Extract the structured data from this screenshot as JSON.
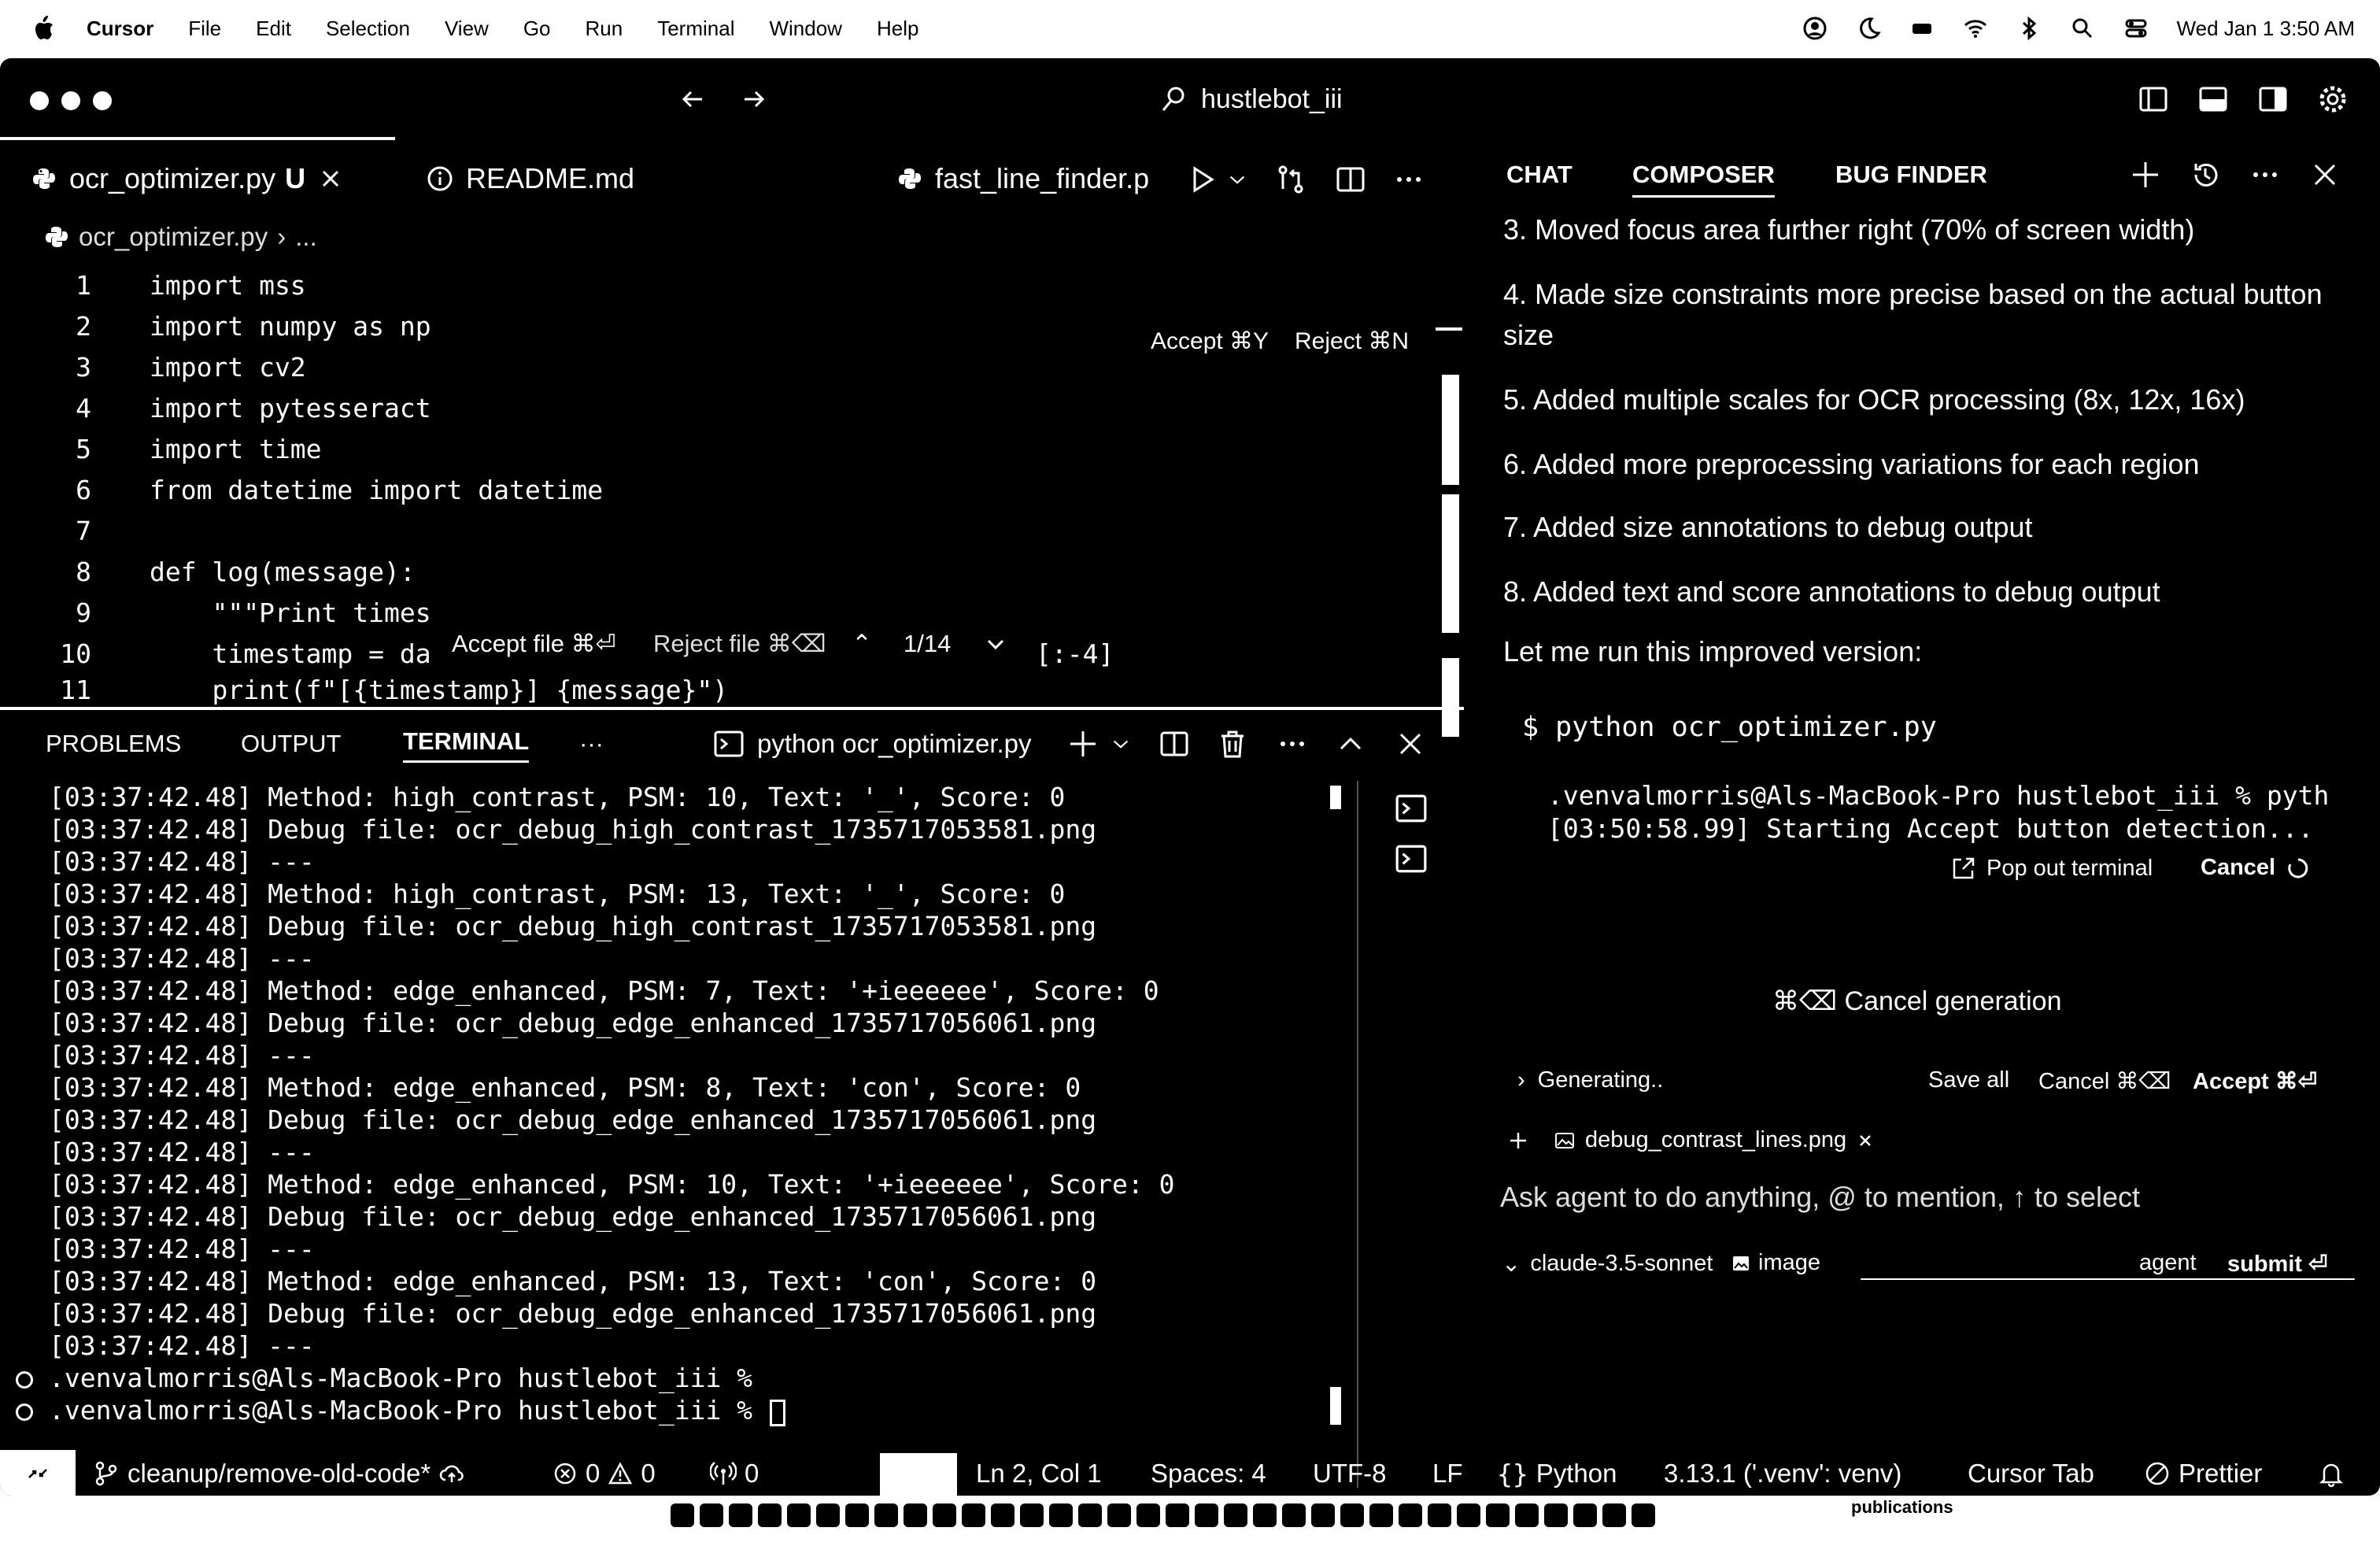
{
  "menubar": {
    "app": "Cursor",
    "items": [
      "File",
      "Edit",
      "Selection",
      "View",
      "Go",
      "Run",
      "Terminal",
      "Window",
      "Help"
    ],
    "clock": "Wed Jan 1  3:50 AM"
  },
  "titlebar": {
    "search": "hustlebot_iii"
  },
  "editor": {
    "tabs": [
      {
        "label": "ocr_optimizer.py",
        "badge": "U"
      },
      {
        "label": "README.md"
      },
      {
        "label": "fast_line_finder.p"
      }
    ],
    "breadcrumb": {
      "file": "ocr_optimizer.py",
      "rest": "..."
    },
    "accept_label": "Accept ⌘Y",
    "reject_label": "Reject ⌘N",
    "lines": [
      {
        "n": "1",
        "t": "import mss"
      },
      {
        "n": "2",
        "t": "import numpy as np"
      },
      {
        "n": "3",
        "t": "import cv2"
      },
      {
        "n": "4",
        "t": "import pytesseract"
      },
      {
        "n": "5",
        "t": "import time"
      },
      {
        "n": "6",
        "t": "from datetime import datetime"
      },
      {
        "n": "7",
        "t": ""
      },
      {
        "n": "8",
        "t": "def log(message):"
      },
      {
        "n": "9",
        "t": "    \"\"\"Print times"
      },
      {
        "n": "10",
        "t": "    timestamp = da"
      },
      {
        "n": "11",
        "t": "    print(f\"[{timestamp}] {message}\")"
      }
    ],
    "line10_tail": "[:-4]",
    "review_bar": {
      "accept_file": "Accept file ⌘⏎",
      "reject_file": "Reject file ⌘⌫",
      "counter": "1/14"
    }
  },
  "panel": {
    "tabs": [
      "PROBLEMS",
      "OUTPUT",
      "TERMINAL"
    ],
    "active_tab": "TERMINAL",
    "terminal_name": "python ocr_optimizer.py",
    "lines": [
      "[03:37:42.48] Method: high_contrast, PSM: 10, Text: '_', Score: 0",
      "[03:37:42.48] Debug file: ocr_debug_high_contrast_1735717053581.png",
      "[03:37:42.48] ---",
      "[03:37:42.48] Method: high_contrast, PSM: 13, Text: '_', Score: 0",
      "[03:37:42.48] Debug file: ocr_debug_high_contrast_1735717053581.png",
      "[03:37:42.48] ---",
      "[03:37:42.48] Method: edge_enhanced, PSM: 7, Text: '+ieeeeee', Score: 0",
      "[03:37:42.48] Debug file: ocr_debug_edge_enhanced_1735717056061.png",
      "[03:37:42.48] ---",
      "[03:37:42.48] Method: edge_enhanced, PSM: 8, Text: 'con', Score: 0",
      "[03:37:42.48] Debug file: ocr_debug_edge_enhanced_1735717056061.png",
      "[03:37:42.48] ---",
      "[03:37:42.48] Method: edge_enhanced, PSM: 10, Text: '+ieeeeee', Score: 0",
      "[03:37:42.48] Debug file: ocr_debug_edge_enhanced_1735717056061.png",
      "[03:37:42.48] ---",
      "[03:37:42.48] Method: edge_enhanced, PSM: 13, Text: 'con', Score: 0",
      "[03:37:42.48] Debug file: ocr_debug_edge_enhanced_1735717056061.png",
      "[03:37:42.48] ---"
    ],
    "prompts": [
      ".venvalmorris@Als-MacBook-Pro hustlebot_iii %",
      ".venvalmorris@Als-MacBook-Pro hustlebot_iii %"
    ]
  },
  "chat": {
    "tabs": [
      "CHAT",
      "COMPOSER",
      "BUG FINDER"
    ],
    "active_tab": "COMPOSER",
    "items": [
      "3. Moved focus area further right (70% of screen width)",
      "4. Made size constraints more precise based on the actual button size",
      "5. Added multiple scales for OCR processing (8x, 12x, 16x)",
      "6. Added more preprocessing variations for each region",
      "7. Added size annotations to debug output",
      "8. Added text and score annotations to debug output"
    ],
    "run_intro": "Let me run this improved version:",
    "command": "$ python ocr_optimizer.py",
    "term_out_1": ".venvalmorris@Als-MacBook-Pro hustlebot_iii % pyth",
    "term_out_2": "[03:50:58.99] Starting Accept button detection...",
    "pop_out": "Pop out terminal",
    "cancel": "Cancel",
    "cancel_generation": "⌘⌫ Cancel generation",
    "generating": "Generating..",
    "save_all": "Save all",
    "cancel_kbd": "Cancel ⌘⌫",
    "accept_kbd": "Accept ⌘⏎",
    "attachment": "debug_contrast_lines.png",
    "placeholder": "Ask agent to do anything, @ to mention, ↑ to select",
    "model": "claude-3.5-sonnet",
    "image_label": "image",
    "agent_label": "agent",
    "submit_label": "submit ⏎"
  },
  "statusbar": {
    "branch": "cleanup/remove-old-code*",
    "errors": "0",
    "warnings": "0",
    "ports": "0",
    "position": "Ln 2, Col 1",
    "spaces": "Spaces: 4",
    "encoding": "UTF-8",
    "eol": "LF",
    "language": "Python",
    "interpreter": "3.13.1 ('.venv': venv)",
    "cursor_tab": "Cursor Tab",
    "prettier": "Prettier"
  },
  "dock": {
    "label": "publications"
  }
}
